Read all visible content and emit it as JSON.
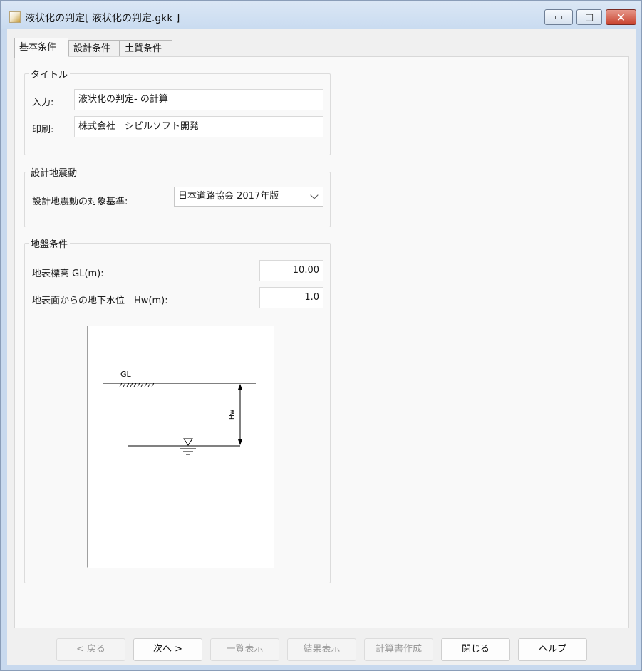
{
  "window": {
    "title": "液状化の判定[ 液状化の判定.gkk ]",
    "minimize_glyph": "▭",
    "maximize_glyph": "□",
    "close_glyph": "✕"
  },
  "tabs": [
    {
      "label": "基本条件",
      "active": true
    },
    {
      "label": "設計条件",
      "active": false
    },
    {
      "label": "土質条件",
      "active": false
    }
  ],
  "title_group": {
    "legend": "タイトル",
    "input_label": "入力:",
    "input_value": "液状化の判定- の計算",
    "print_label": "印刷:",
    "print_value": "株式会社　シビルソフト開発"
  },
  "seismic_group": {
    "legend": "設計地震動",
    "standard_label": "設計地震動の対象基準:",
    "standard_value": "日本道路協会 2017年版"
  },
  "ground_group": {
    "legend": "地盤条件",
    "gl_label": "地表標高 GL(m):",
    "gl_value": "10.00",
    "hw_label": "地表面からの地下水位　Hw(m):",
    "hw_value": "1.0",
    "diagram": {
      "gl_text": "GL",
      "hw_text": "Hw"
    }
  },
  "buttons": {
    "back": "< 戻る",
    "next": "次へ >",
    "list": "一覧表示",
    "result": "結果表示",
    "report": "計算書作成",
    "close": "閉じる",
    "help": "ヘルプ"
  }
}
